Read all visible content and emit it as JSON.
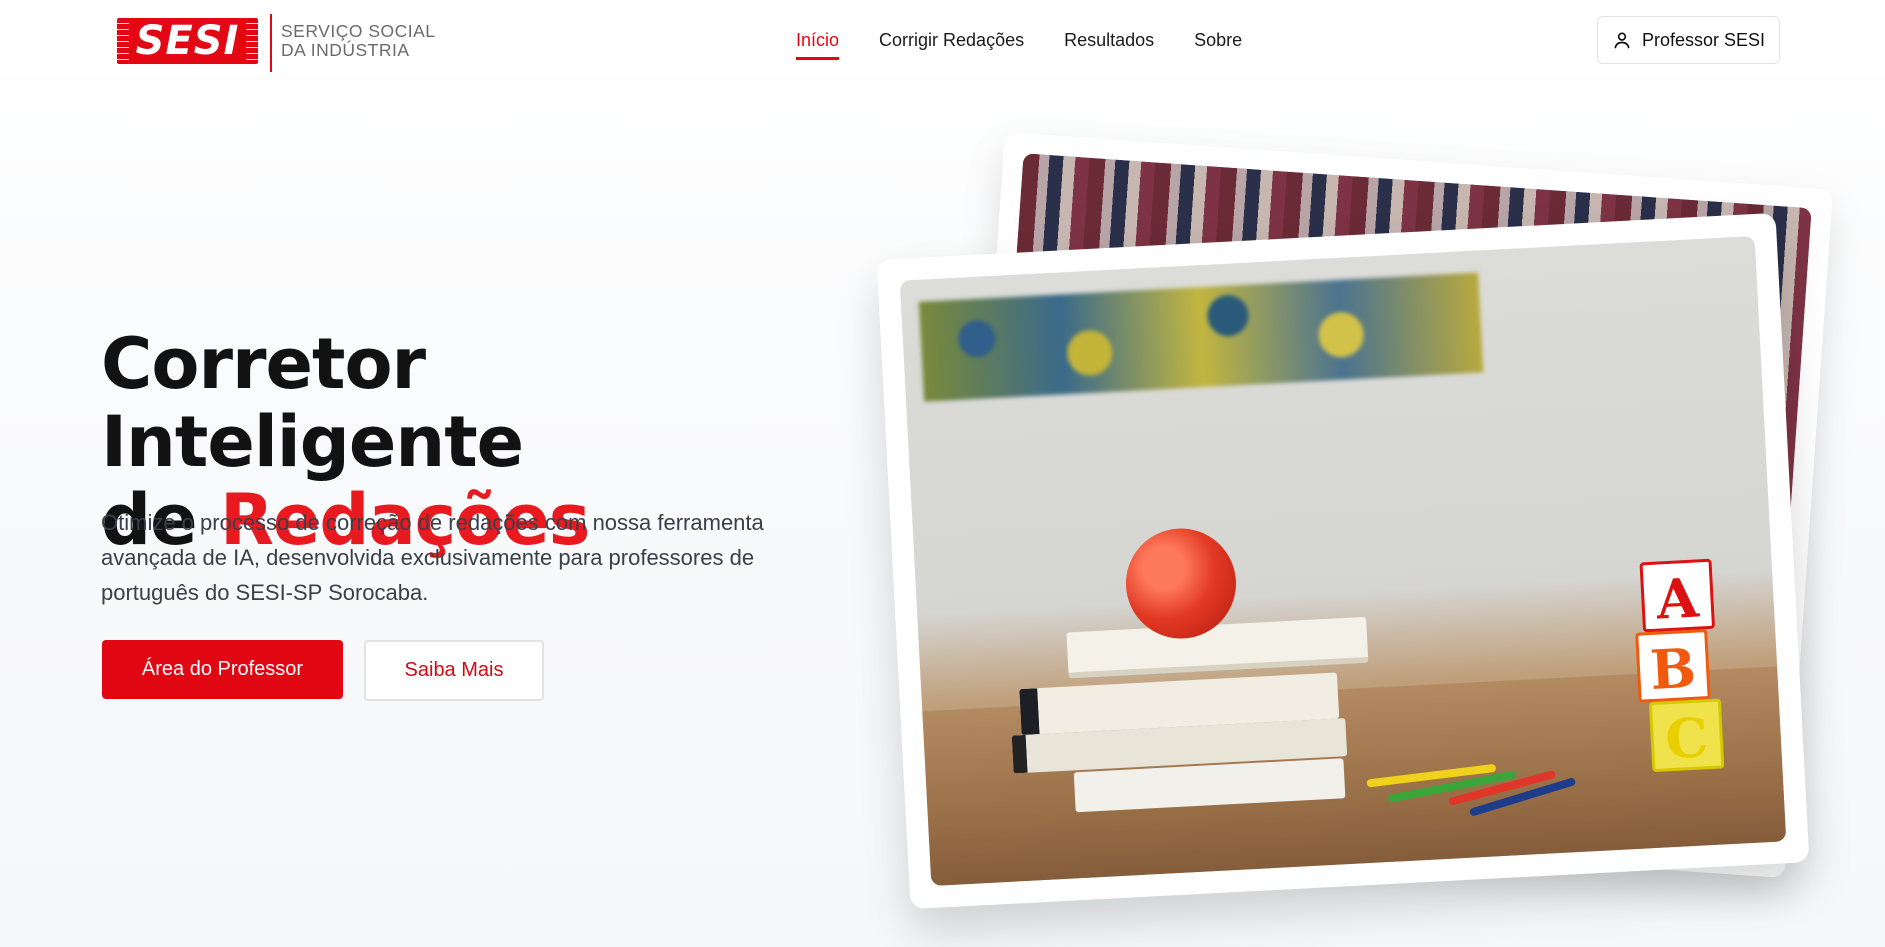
{
  "header": {
    "logo": {
      "mark": "SESI",
      "text_line1": "SERVIÇO SOCIAL",
      "text_line2": "DA INDÚSTRIA"
    },
    "nav": [
      {
        "label": "Início",
        "active": true
      },
      {
        "label": "Corrigir Redações",
        "active": false
      },
      {
        "label": "Resultados",
        "active": false
      },
      {
        "label": "Sobre",
        "active": false
      }
    ],
    "user_button": {
      "label": "Professor SESI",
      "icon": "user-icon"
    }
  },
  "hero": {
    "title_part1": "Corretor Inteligente",
    "title_part2": "de ",
    "title_accent": "Redações",
    "description": "Otimize o processo de correção de redações com nossa ferramenta avançada de IA, desenvolvida exclusivamente para professores de português do SESI-SP Sorocaba.",
    "primary_button": "Área do Professor",
    "secondary_button": "Saiba Mais"
  },
  "colors": {
    "accent": "#e30613",
    "text": "#121212",
    "muted": "#3a3f4a"
  },
  "image": {
    "blocks": [
      "A",
      "B",
      "C"
    ]
  }
}
